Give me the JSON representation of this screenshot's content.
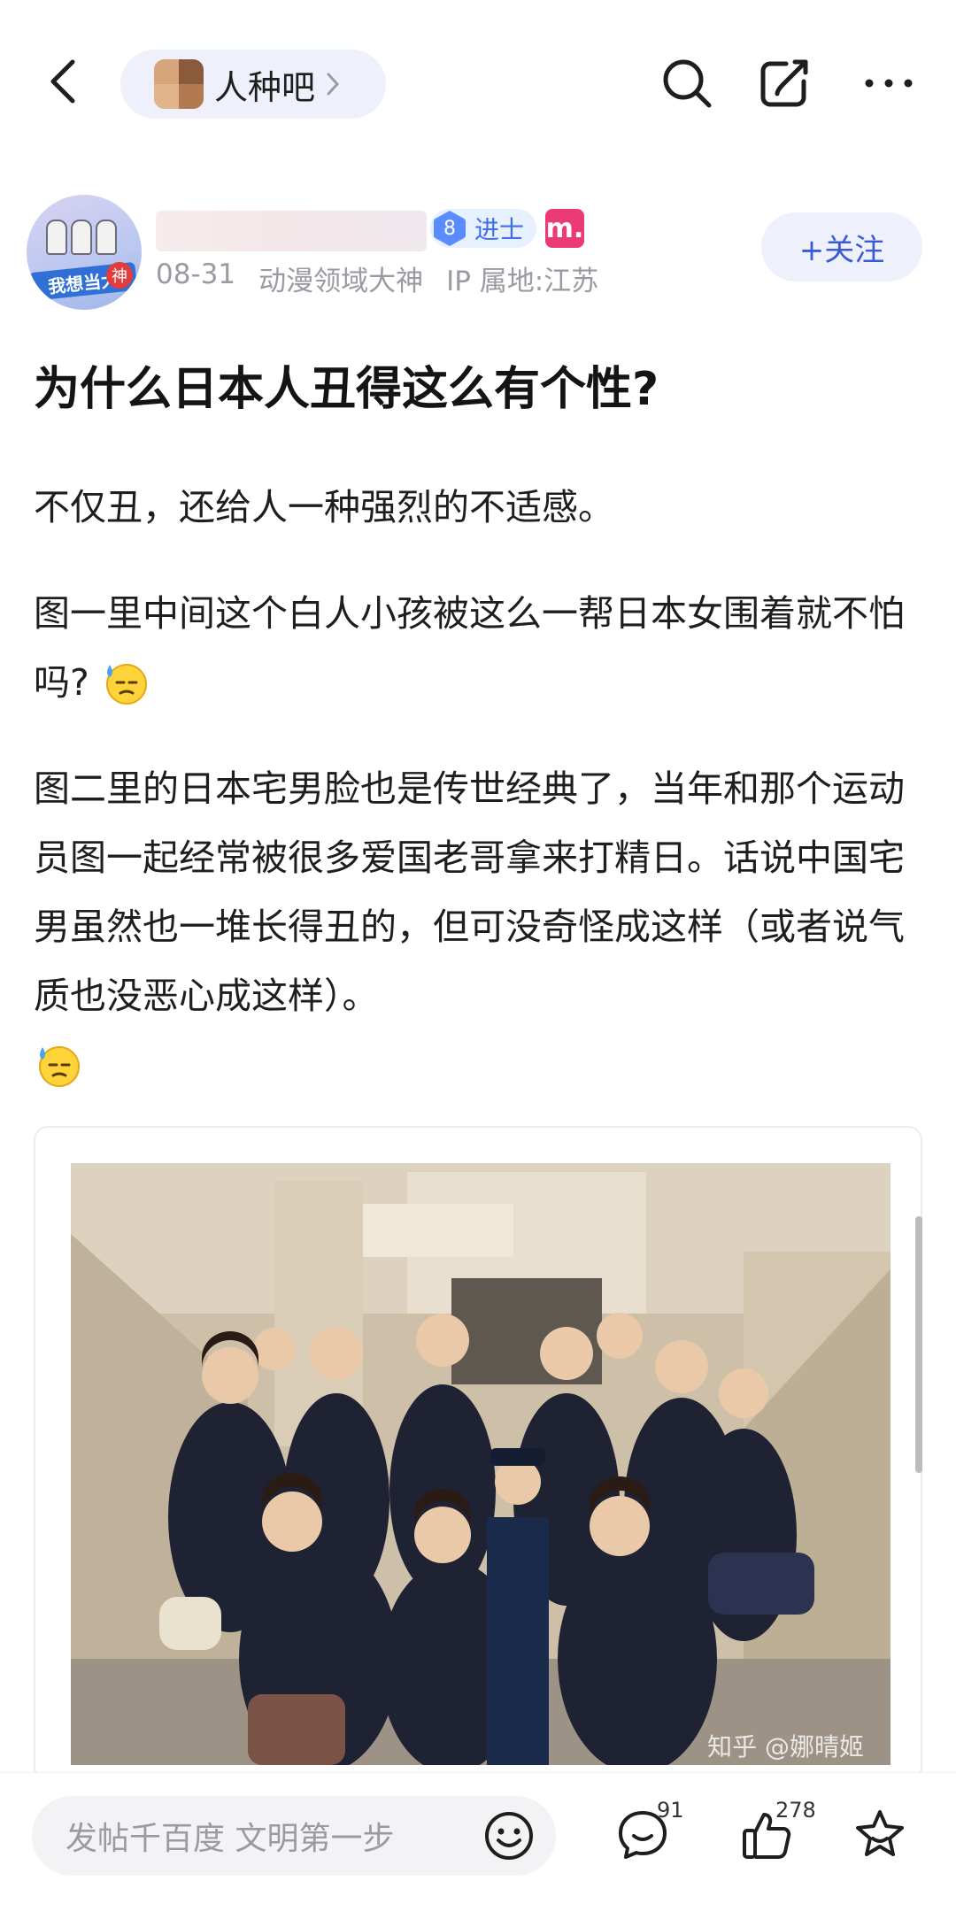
{
  "topbar": {
    "forum_name": "人种吧",
    "icons": {
      "back": "chevron-left-icon",
      "search": "search-icon",
      "share": "share-icon",
      "more": "more-dots-icon"
    }
  },
  "author": {
    "level": "8",
    "level_title": "进士",
    "member_badge": "m.",
    "date": "08-31",
    "honor": "动漫领域大神",
    "ip": "IP 属地:江苏",
    "avatar_banner": "我想当大",
    "avatar_badge": "神"
  },
  "follow": {
    "label": "+关注"
  },
  "post": {
    "title": "为什么日本人丑得这么有个性?",
    "p1": "不仅丑，还给人一种强烈的不适感。",
    "p2": "图一里中间这个白人小孩被这么一帮日本女围着就不怕吗?",
    "p3": "图二里的日本宅男脸也是传世经典了，当年和那个运动员图一起经常被很多爱国老哥拿来打精日。话说中国宅男虽然也一堆长得丑的，但可没奇怪成这样（或者说气质也没恶心成这样）。"
  },
  "image": {
    "watermark": "知乎 @娜晴姬"
  },
  "bottombar": {
    "comment_placeholder": "发帖千百度 文明第一步",
    "comment_count": "91",
    "like_count": "278",
    "icons": {
      "emoji": "emoji-icon",
      "comment": "comment-icon",
      "like": "thumb-up-icon",
      "favorite": "star-icon"
    }
  },
  "colors": {
    "accent": "#3b5bd6",
    "chip_bg": "#eef0fb",
    "meta_text": "#9a9aa2",
    "level_blue": "#5a8cff",
    "member_pink": "#ec3a78"
  }
}
